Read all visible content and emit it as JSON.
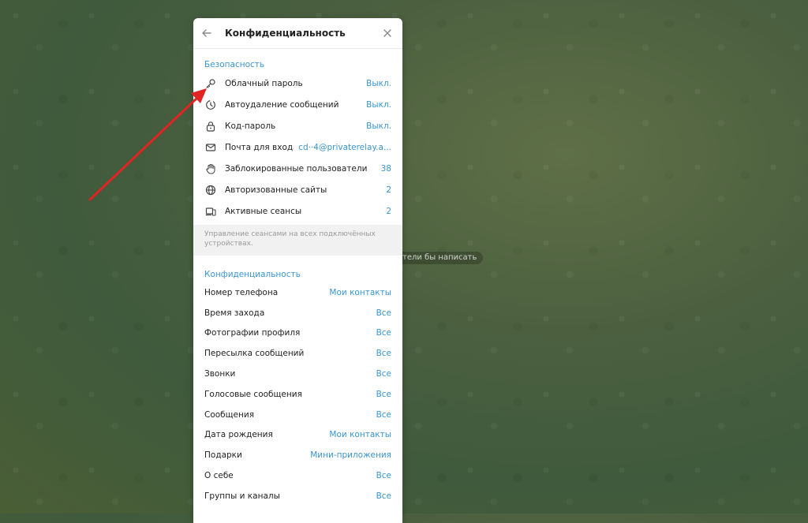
{
  "background": {
    "chat_hint": "тели бы написать"
  },
  "header": {
    "title": "Конфиденциальность"
  },
  "security": {
    "title": "Безопасность",
    "items": [
      {
        "icon": "key-icon",
        "label": "Облачный пароль",
        "value": "Выкл."
      },
      {
        "icon": "timer-icon",
        "label": "Автоудаление сообщений",
        "value": "Выкл."
      },
      {
        "icon": "lock-icon",
        "label": "Код-пароль",
        "value": "Выкл."
      },
      {
        "icon": "mail-icon",
        "label": "Почта для входа",
        "value": "cd··4@privaterelay.a..."
      },
      {
        "icon": "hand-icon",
        "label": "Заблокированные пользователи",
        "value": "38"
      },
      {
        "icon": "globe-icon",
        "label": "Авторизованные сайты",
        "value": "2"
      },
      {
        "icon": "devices-icon",
        "label": "Активные сеансы",
        "value": "2"
      }
    ],
    "note": "Управление сеансами на всех подключённых устройствах."
  },
  "privacy": {
    "title": "Конфиденциальность",
    "items": [
      {
        "label": "Номер телефона",
        "value": "Мои контакты"
      },
      {
        "label": "Время захода",
        "value": "Все"
      },
      {
        "label": "Фотографии профиля",
        "value": "Все"
      },
      {
        "label": "Пересылка сообщений",
        "value": "Все"
      },
      {
        "label": "Звонки",
        "value": "Все"
      },
      {
        "label": "Голосовые сообщения",
        "value": "Все"
      },
      {
        "label": "Сообщения",
        "value": "Все"
      },
      {
        "label": "Дата рождения",
        "value": "Мои контакты"
      },
      {
        "label": "Подарки",
        "value": "Мини-приложения"
      },
      {
        "label": "О себе",
        "value": "Все"
      },
      {
        "label": "Группы и каналы",
        "value": "Все"
      }
    ]
  },
  "colors": {
    "accent": "#3a95d0",
    "arrow": "#e02424"
  }
}
